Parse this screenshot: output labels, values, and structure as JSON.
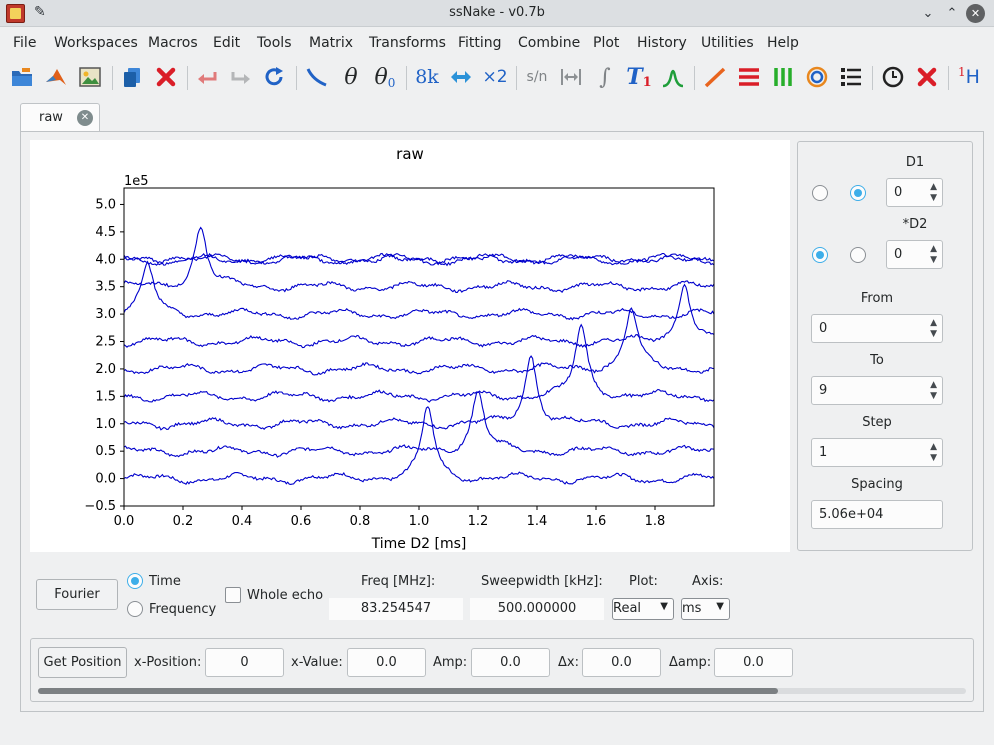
{
  "window": {
    "title": "ssNake - v0.7b"
  },
  "menu": [
    "File",
    "Workspaces",
    "Macros",
    "Edit",
    "Tools",
    "Matrix",
    "Transforms",
    "Fitting",
    "Combine",
    "Plot",
    "History",
    "Utilities",
    "Help"
  ],
  "toolbar": {
    "icons": [
      "open-folder-icon",
      "matlab-icon",
      "image-icon",
      "copy-icon",
      "delete-icon",
      "undo-icon",
      "redo-icon",
      "reload-icon",
      "baseline-icon",
      "phase-icon",
      "phase-zero-icon",
      "size-8k-icon",
      "swap-icon",
      "multiply-2-icon",
      "snr-icon",
      "fwhm-icon",
      "integral-icon",
      "t1-icon",
      "peak-fit-icon",
      "line-plot-icon",
      "stack-plot-icon",
      "array-plot-icon",
      "contour-icon",
      "list-icon",
      "clock-icon",
      "close-icon",
      "nucleus-h1-icon"
    ],
    "glyphs": {
      "size_8k": "8k",
      "multiply_2": "×2",
      "snr": "s/n",
      "integral": "∫",
      "t1": "T",
      "t1_sub": "1",
      "h1_sup": "1",
      "h1": "H",
      "theta": "θ",
      "theta_zero": "θ",
      "theta_zero_sub": "0"
    }
  },
  "tab": {
    "label": "raw"
  },
  "colors": {
    "accent": "#3daee9",
    "trace": "#0000cc"
  },
  "plot": {
    "title": "raw",
    "xlabel": "Time D2 [ms]",
    "y_offset_label": "1e5",
    "x_ticks": [
      "0.0",
      "0.2",
      "0.4",
      "0.6",
      "0.8",
      "1.0",
      "1.2",
      "1.4",
      "1.6",
      "1.8"
    ],
    "y_ticks": [
      "5.0",
      "4.5",
      "4.0",
      "3.5",
      "3.0",
      "2.5",
      "2.0",
      "1.5",
      "1.0",
      "0.5",
      "0.0",
      "−0.5"
    ]
  },
  "chart_data": {
    "type": "line",
    "title": "raw",
    "xlabel": "Time D2 [ms]",
    "ylabel": "",
    "xlim": [
      0.0,
      2.0
    ],
    "ylim": [
      -0.5,
      5.3
    ],
    "y_scale": "1e5",
    "x_step": 0.005,
    "series_count": 10,
    "baselines": [
      0.0,
      0.5,
      1.0,
      1.5,
      2.0,
      2.5,
      3.0,
      3.5,
      4.0,
      4.0
    ],
    "peak_positions": [
      1.03,
      1.2,
      1.38,
      1.55,
      1.72,
      1.9,
      0.08,
      0.26,
      0.0,
      0.0
    ],
    "peak_heights": [
      1.3,
      1.1,
      1.25,
      1.25,
      1.1,
      1.1,
      0.9,
      1.1,
      0.0,
      0.0
    ],
    "grid": false
  },
  "side": {
    "d1_label": "D1",
    "d2_label": "*D2",
    "d1_value": "0",
    "d2_value": "0",
    "from_label": "From",
    "from_value": "0",
    "to_label": "To",
    "to_value": "9",
    "step_label": "Step",
    "step_value": "1",
    "spacing_label": "Spacing",
    "spacing_value": "5.06e+04"
  },
  "bottom": {
    "fourier_button": "Fourier",
    "time_label": "Time",
    "frequency_label": "Frequency",
    "whole_echo_label": "Whole echo",
    "freq_label": "Freq [MHz]:",
    "freq_value": "83.254547",
    "sweep_label": "Sweepwidth [kHz]:",
    "sweep_value": "500.000000",
    "plot_label": "Plot:",
    "plot_value": "Real",
    "axis_label": "Axis:",
    "axis_value": "ms"
  },
  "position": {
    "get_button": "Get Position",
    "xpos_label": "x-Position:",
    "xpos_value": "0",
    "xval_label": "x-Value:",
    "xval_value": "0.0",
    "amp_label": "Amp:",
    "amp_value": "0.0",
    "dx_label": "Δx:",
    "dx_value": "0.0",
    "damp_label": "Δamp:",
    "damp_value": "0.0"
  }
}
